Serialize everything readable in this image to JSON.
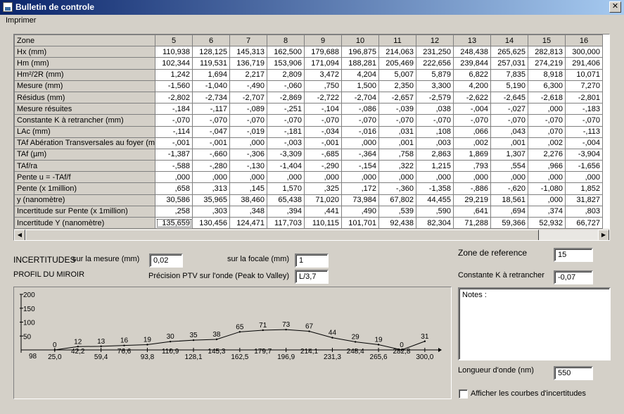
{
  "window": {
    "title": "Bulletin de controle",
    "close_glyph": "✕"
  },
  "menu": {
    "print": "Imprimer"
  },
  "grid": {
    "row_header_label": "Zone",
    "zones": [
      "5",
      "6",
      "7",
      "8",
      "9",
      "10",
      "11",
      "12",
      "13",
      "14",
      "15",
      "16"
    ],
    "rows": [
      {
        "label": "Hx (mm)",
        "values": [
          "110,938",
          "128,125",
          "145,313",
          "162,500",
          "179,688",
          "196,875",
          "214,063",
          "231,250",
          "248,438",
          "265,625",
          "282,813",
          "300,000"
        ]
      },
      {
        "label": "Hm (mm)",
        "values": [
          "102,344",
          "119,531",
          "136,719",
          "153,906",
          "171,094",
          "188,281",
          "205,469",
          "222,656",
          "239,844",
          "257,031",
          "274,219",
          "291,406"
        ]
      },
      {
        "label": "Hm²/2R (mm)",
        "values": [
          "1,242",
          "1,694",
          "2,217",
          "2,809",
          "3,472",
          "4,204",
          "5,007",
          "5,879",
          "6,822",
          "7,835",
          "8,918",
          "10,071"
        ]
      },
      {
        "label": "Mesure (mm)",
        "values": [
          "-1,560",
          "-1,040",
          "-,490",
          "-,060",
          ",750",
          "1,500",
          "2,350",
          "3,300",
          "4,200",
          "5,190",
          "6,300",
          "7,270"
        ]
      },
      {
        "label": "Résidus (mm)",
        "values": [
          "-2,802",
          "-2,734",
          "-2,707",
          "-2,869",
          "-2,722",
          "-2,704",
          "-2,657",
          "-2,579",
          "-2,622",
          "-2,645",
          "-2,618",
          "-2,801"
        ]
      },
      {
        "label": "Mesure résuites",
        "values": [
          "-,184",
          "-,117",
          "-,089",
          "-,251",
          "-,104",
          "-,086",
          "-,039",
          ",038",
          "-,004",
          "-,027",
          ",000",
          "-,183"
        ]
      },
      {
        "label": "Constante K à retrancher (mm)",
        "values": [
          "-,070",
          "-,070",
          "-,070",
          "-,070",
          "-,070",
          "-,070",
          "-,070",
          "-,070",
          "-,070",
          "-,070",
          "-,070",
          "-,070"
        ]
      },
      {
        "label": "LAc (mm)",
        "values": [
          "-,114",
          "-,047",
          "-,019",
          "-,181",
          "-,034",
          "-,016",
          ",031",
          ",108",
          ",066",
          ",043",
          ",070",
          "-,113"
        ]
      },
      {
        "label": "TAf Abération Transversales au foyer (mm)",
        "values": [
          "-,001",
          "-,001",
          ",000",
          "-,003",
          "-,001",
          ",000",
          ",001",
          ",003",
          ",002",
          ",001",
          ",002",
          "-,004"
        ]
      },
      {
        "label": "TAf (µm)",
        "values": [
          "-1,387",
          "-,660",
          "-,306",
          "-3,309",
          "-,685",
          "-,364",
          ",758",
          "2,863",
          "1,869",
          "1,307",
          "2,276",
          "-3,904"
        ]
      },
      {
        "label": "TAf/ra",
        "values": [
          "-,588",
          "-,280",
          "-,130",
          "-1,404",
          "-,290",
          "-,154",
          ",322",
          "1,215",
          ",793",
          ",554",
          ",966",
          "-1,656"
        ]
      },
      {
        "label": "Pente u = -TAf/f",
        "values": [
          ",000",
          ",000",
          ",000",
          ",000",
          ",000",
          ",000",
          ",000",
          ",000",
          ",000",
          ",000",
          ",000",
          ",000"
        ]
      },
      {
        "label": "Pente (x 1million)",
        "values": [
          ",658",
          ",313",
          ",145",
          "1,570",
          ",325",
          ",172",
          "-,360",
          "-1,358",
          "-,886",
          "-,620",
          "-1,080",
          "1,852"
        ]
      },
      {
        "label": "y  (nanomètre)",
        "values": [
          "30,586",
          "35,965",
          "38,460",
          "65,438",
          "71,020",
          "73,984",
          "67,802",
          "44,455",
          "29,219",
          "18,561",
          ",000",
          "31,827"
        ]
      },
      {
        "label": "Incertitude sur Pente (x 1million)",
        "values": [
          ",258",
          ",303",
          ",348",
          ",394",
          ",441",
          ",490",
          ",539",
          ",590",
          ",641",
          ",694",
          ",374",
          ",803"
        ]
      },
      {
        "label": "Incertitude Y (nanomètre)",
        "values": [
          "135,659",
          "130,456",
          "124,471",
          "117,703",
          "110,115",
          "101,701",
          "92,438",
          "82,304",
          "71,288",
          "59,366",
          "52,932",
          "66,727"
        ]
      }
    ],
    "scroll_left_glyph": "◀",
    "scroll_right_glyph": "▶"
  },
  "form": {
    "incertitudes_label": "INCERTITUDES",
    "sur_mesure_label": "sur la mesure (mm)",
    "sur_mesure_value": "0,02",
    "sur_focale_label": "sur la focale (mm)",
    "sur_focale_value": "1",
    "profil_label": "PROFIL DU MIROIR",
    "precision_label": "Précision PTV  sur l'onde  (Peak to Valley)",
    "precision_value": "L/3,7",
    "zone_ref_label": "Zone de reference",
    "zone_ref_value": "15",
    "constante_label": "Constante K à retrancher",
    "constante_value": "-0,07",
    "notes_label": "Notes :",
    "longueur_label": "Longueur d'onde (nm)",
    "longueur_value": "550",
    "checkbox_label": "Afficher les courbes d'incertitudes"
  },
  "chart_data": {
    "type": "line",
    "y_ticks": [
      "200",
      "150",
      "100",
      "50"
    ],
    "baseline_label": "98",
    "x_tick_labels": [
      "25,0",
      "59,4",
      "93,8",
      "128,1",
      "162,5",
      "196,9",
      "231,3",
      "265,6",
      "300,0"
    ],
    "x_tick_values": [
      25.0,
      59.4,
      93.8,
      128.1,
      162.5,
      196.9,
      231.3,
      265.6,
      300.0
    ],
    "offset_tick_labels": [
      "42,2",
      "76,6",
      "110,9",
      "145,3",
      "179,7",
      "214,1",
      "248,4",
      "282,8"
    ],
    "offset_tick_values": [
      42.2,
      76.6,
      110.9,
      145.3,
      179.7,
      214.1,
      248.4,
      282.8
    ],
    "xlim": [
      0,
      310
    ],
    "ylim": [
      0,
      200
    ],
    "point_labels": [
      "0",
      "12",
      "13",
      "16",
      "19",
      "30",
      "35",
      "38",
      "65",
      "71",
      "73",
      "67",
      "44",
      "29",
      "19",
      "0",
      "31"
    ],
    "points_x": [
      25.0,
      42.2,
      59.4,
      76.6,
      93.8,
      110.9,
      128.1,
      145.3,
      162.5,
      179.7,
      196.9,
      214.1,
      231.3,
      248.4,
      265.6,
      282.8,
      300.0
    ],
    "points_y": [
      0,
      12,
      13,
      16,
      19,
      30,
      35,
      38,
      65,
      71,
      73,
      67,
      44,
      29,
      19,
      0,
      31
    ]
  }
}
